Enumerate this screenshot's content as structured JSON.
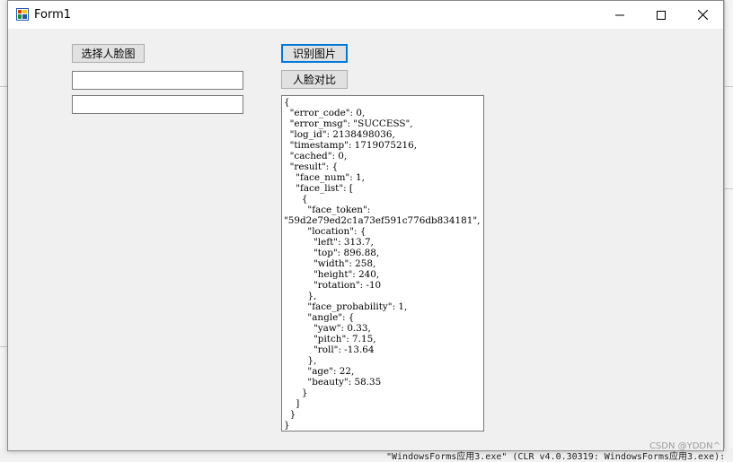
{
  "window": {
    "title": "Form1"
  },
  "buttons": {
    "select_face_image": "选择人脸图",
    "recognize_image": "识别图片",
    "face_compare": "人脸对比"
  },
  "inputs": {
    "path1_value": "",
    "path2_value": ""
  },
  "result_text": "{\n  \"error_code\": 0,\n  \"error_msg\": \"SUCCESS\",\n  \"log_id\": 2138498036,\n  \"timestamp\": 1719075216,\n  \"cached\": 0,\n  \"result\": {\n    \"face_num\": 1,\n    \"face_list\": [\n      {\n        \"face_token\":\n\"59d2e79ed2c1a73ef591c776db834181\",\n        \"location\": {\n          \"left\": 313.7,\n          \"top\": 896.88,\n          \"width\": 258,\n          \"height\": 240,\n          \"rotation\": -10\n        },\n        \"face_probability\": 1,\n        \"angle\": {\n          \"yaw\": 0.33,\n          \"pitch\": 7.15,\n          \"roll\": -13.64\n        },\n        \"age\": 22,\n        \"beauty\": 58.35\n      }\n    ]\n  }\n}",
  "background": {
    "output_line": "\"WindowsForms应用3.exe\" (CLR v4.0.30319: WindowsForms应用3.exe):",
    "watermark": "CSDN @YDDN^"
  },
  "colors": {
    "focus_border": "#0078d7",
    "button_face": "#e1e1e1",
    "form_back": "#f0f0f0"
  }
}
